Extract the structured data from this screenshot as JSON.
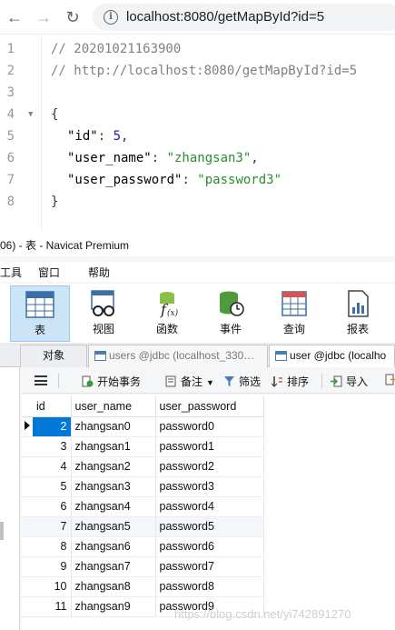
{
  "browser": {
    "url": "localhost:8080/getMapById?id=5"
  },
  "json_view": {
    "lines": [
      {
        "num": "1",
        "comment": "// 20201021163900"
      },
      {
        "num": "2",
        "comment": "// http://localhost:8080/getMapById?id=5"
      },
      {
        "num": "3"
      },
      {
        "num": "4",
        "brace": "{"
      },
      {
        "num": "5",
        "key": "\"id\"",
        "sep": ": ",
        "num_value": "5",
        "tail": ","
      },
      {
        "num": "6",
        "key": "\"user_name\"",
        "sep": ": ",
        "str_value": "\"zhangsan3\"",
        "tail": ","
      },
      {
        "num": "7",
        "key": "\"user_password\"",
        "sep": ": ",
        "str_value": "\"password3\""
      },
      {
        "num": "8",
        "brace": "}"
      }
    ]
  },
  "navicat": {
    "title": "06) - 表 - Navicat Premium",
    "menu": [
      "工具",
      "窗口",
      "帮助"
    ],
    "toolbar": [
      {
        "label": "表",
        "icon": "table-icon",
        "active": true
      },
      {
        "label": "视图",
        "icon": "view-icon"
      },
      {
        "label": "函数",
        "icon": "function-icon"
      },
      {
        "label": "事件",
        "icon": "event-icon"
      },
      {
        "label": "查询",
        "icon": "query-icon"
      },
      {
        "label": "报表",
        "icon": "report-icon"
      }
    ],
    "tabs": {
      "objects": "对象",
      "tab1": "users @jdbc (localhost_330…",
      "tab2": "user @jdbc (localho"
    },
    "actions": {
      "begin_txn": "开始事务",
      "memo": "备注",
      "filter": "筛选",
      "sort": "排序",
      "import": "导入"
    },
    "grid": {
      "columns": [
        "id",
        "user_name",
        "user_password"
      ],
      "rows": [
        {
          "id": "2",
          "user_name": "zhangsan0",
          "user_password": "password0"
        },
        {
          "id": "3",
          "user_name": "zhangsan1",
          "user_password": "password1"
        },
        {
          "id": "4",
          "user_name": "zhangsan2",
          "user_password": "password2"
        },
        {
          "id": "5",
          "user_name": "zhangsan3",
          "user_password": "password3"
        },
        {
          "id": "6",
          "user_name": "zhangsan4",
          "user_password": "password4"
        },
        {
          "id": "7",
          "user_name": "zhangsan5",
          "user_password": "password5"
        },
        {
          "id": "8",
          "user_name": "zhangsan6",
          "user_password": "password6"
        },
        {
          "id": "9",
          "user_name": "zhangsan7",
          "user_password": "password7"
        },
        {
          "id": "10",
          "user_name": "zhangsan8",
          "user_password": "password8"
        },
        {
          "id": "11",
          "user_name": "zhangsan9",
          "user_password": "password9"
        }
      ]
    }
  },
  "watermark": "https://blog.csdn.net/yi742891270"
}
